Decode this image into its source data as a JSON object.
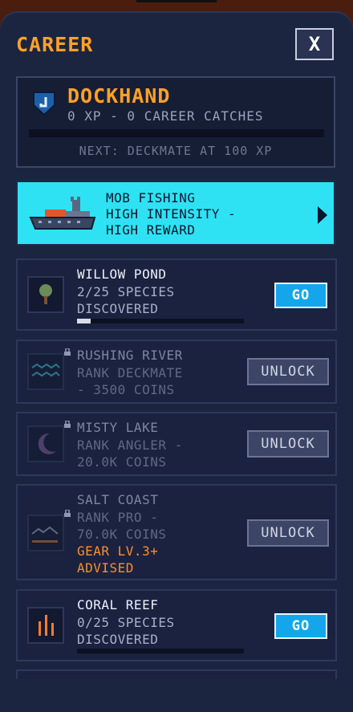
{
  "header": {
    "title": "CAREER",
    "close_label": "X"
  },
  "rank": {
    "name": "DOCKHAND",
    "subtitle": "0 XP - 0 CAREER CATCHES",
    "progress": 0,
    "next": "NEXT: DECKMATE AT 100 XP",
    "shield_glyph": "J"
  },
  "mob": {
    "line1": "MOB FISHING",
    "line2": "HIGH INTENSITY -",
    "line3": "HIGH REWARD"
  },
  "locations": [
    {
      "name": "WILLOW POND",
      "info1": "2/25 SPECIES",
      "info2": "DISCOVERED",
      "button": "GO",
      "progress": 0.08
    },
    {
      "name": "RUSHING RIVER",
      "info1": "RANK DECKMATE",
      "info2": "- 3500 COINS",
      "button": "UNLOCK"
    },
    {
      "name": "MISTY LAKE",
      "info1": "RANK ANGLER -",
      "info2": "20.0K COINS",
      "button": "UNLOCK"
    },
    {
      "name": "SALT COAST",
      "info1": "RANK PRO -",
      "info2": "70.0K COINS",
      "warn1": "GEAR LV.3+",
      "warn2": "ADVISED",
      "button": "UNLOCK"
    },
    {
      "name": "CORAL REEF",
      "info1": "0/25 SPECIES",
      "info2": "DISCOVERED",
      "button": "GO",
      "progress": 0
    }
  ],
  "icons": [
    "tree-icon",
    "river-icon",
    "moon-icon",
    "coast-icon",
    "coral-icon",
    "lock-icon",
    "shield-icon",
    "boat-icon",
    "arrow-right-icon"
  ],
  "colors": {
    "accent": "#ffa126",
    "mob_bg": "#2ee2f4",
    "go_button": "#14a6ea",
    "warning": "#ff8e26",
    "panel": "#1c2540"
  }
}
